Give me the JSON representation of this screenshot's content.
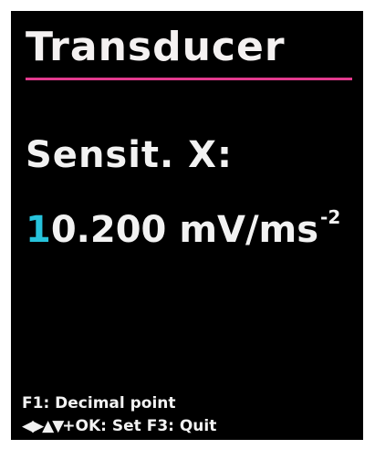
{
  "header": {
    "title": "Transducer"
  },
  "parameter": {
    "label": "Sensit. X:",
    "value_cursor_digit": "1",
    "value_rest": "0.200",
    "unit": "mV/ms",
    "unit_exponent": "-2"
  },
  "footer": {
    "line1": "F1: Decimal point",
    "line2_arrows": "◀▶▲▼",
    "line2_rest": "+OK: Set F3: Quit"
  },
  "colors": {
    "background": "#000000",
    "text": "#f2f2f2",
    "title_underline": "#e23a8e",
    "cursor_digit": "#27c3dc"
  }
}
